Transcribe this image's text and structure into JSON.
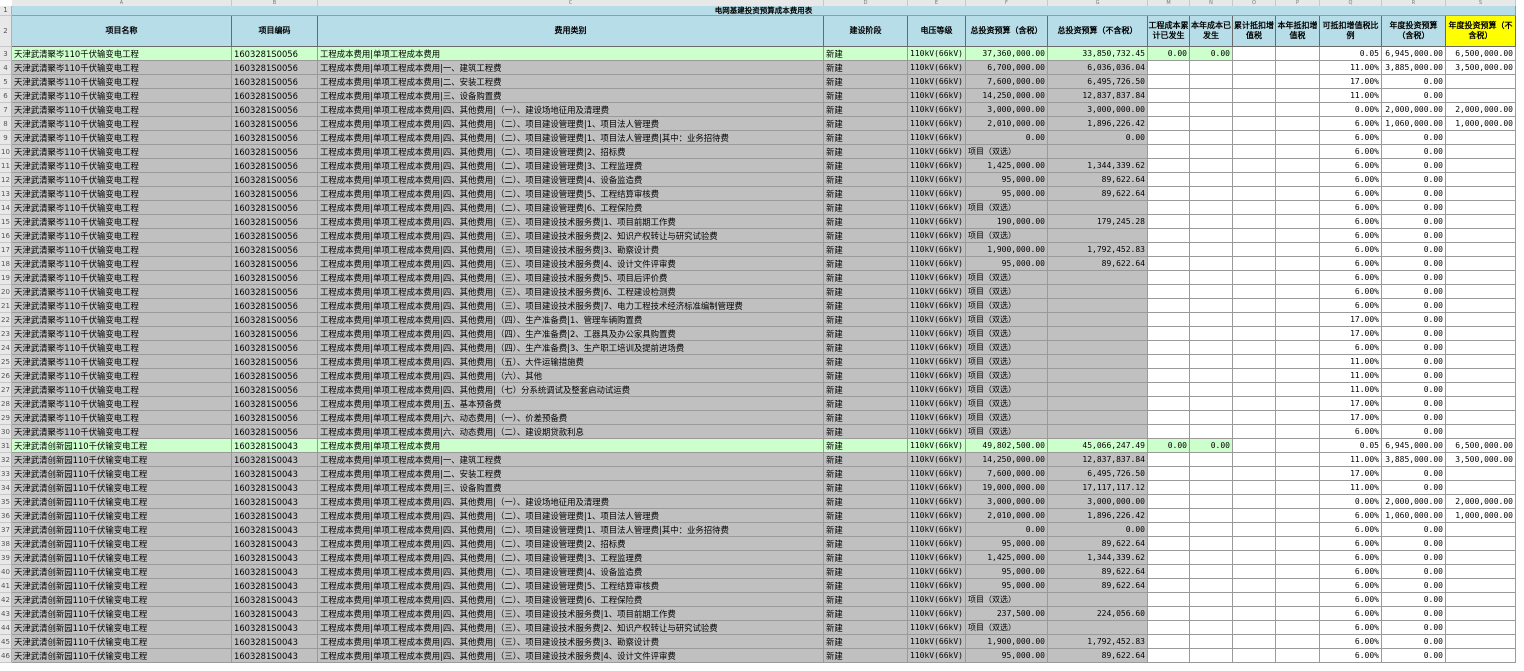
{
  "sheet": {
    "title": "电网基建投资预算成本费用表",
    "col_letters": [
      "A",
      "B",
      "C",
      "D",
      "E",
      "F",
      "G",
      "H",
      "I",
      "J",
      "K",
      "L",
      "M",
      "N",
      "O",
      "P",
      "Q",
      "R",
      "S"
    ],
    "headers": [
      "项目名称",
      "项目编码",
      "费用类别",
      "建设阶段",
      "电压等级",
      "总投资预算（含税）",
      "总投资预算（不含税）",
      "工程成本累计已发生",
      "本年成本已发生",
      "累计抵扣增值税",
      "本年抵扣增值税",
      "可抵扣增值税比例",
      "年度投资预算（含税）",
      "年度投资预算（不含税）"
    ],
    "rows": [
      {
        "n": "3",
        "name": "天津武清聚岑110千伏输变电工程",
        "code": "1603281S0056",
        "cat": "工程成本费用|单项工程成本费用",
        "stage": "新建",
        "volt": "110kV(66kV)",
        "tot": "37,360,000.00",
        "totn": "33,850,732.45",
        "m": "0.00",
        "n2": "0.00",
        "o": "",
        "p": "",
        "ratio": "0.05",
        "ann": "6,945,000.00",
        "annn": "6,500,000.00",
        "hl": true
      },
      {
        "n": "4",
        "name": "天津武清聚岑110千伏输变电工程",
        "code": "1603281S0056",
        "cat": "工程成本费用|单项工程成本费用|一、建筑工程费",
        "stage": "新建",
        "volt": "110kV(66kV)",
        "tot": "6,700,000.00",
        "totn": "6,036,036.04",
        "ratio": "11.00%",
        "ann": "3,885,000.00",
        "annn": "3,500,000.00"
      },
      {
        "n": "5",
        "name": "天津武清聚岑110千伏输变电工程",
        "code": "1603281S0056",
        "cat": "工程成本费用|单项工程成本费用|二、安装工程费",
        "stage": "新建",
        "volt": "110kV(66kV)",
        "tot": "7,600,000.00",
        "totn": "6,495,726.50",
        "ratio": "17.00%",
        "ann": "0.00",
        "annn": ""
      },
      {
        "n": "6",
        "name": "天津武清聚岑110千伏输变电工程",
        "code": "1603281S0056",
        "cat": "工程成本费用|单项工程成本费用|三、设备购置费",
        "stage": "新建",
        "volt": "110kV(66kV)",
        "tot": "14,250,000.00",
        "totn": "12,837,837.84",
        "ratio": "11.00%",
        "ann": "0.00",
        "annn": ""
      },
      {
        "n": "7",
        "name": "天津武清聚岑110千伏输变电工程",
        "code": "1603281S0056",
        "cat": "工程成本费用|单项工程成本费用|四、其他费用|（一）、建设场地征用及清理费",
        "stage": "新建",
        "volt": "110kV(66kV)",
        "tot": "3,000,000.00",
        "totn": "3,000,000.00",
        "ratio": "0.00%",
        "ann": "2,000,000.00",
        "annn": "2,000,000.00"
      },
      {
        "n": "8",
        "name": "天津武清聚岑110千伏输变电工程",
        "code": "1603281S0056",
        "cat": "工程成本费用|单项工程成本费用|四、其他费用|（二）、项目建设管理费|1、项目法人管理费",
        "stage": "新建",
        "volt": "110kV(66kV)",
        "tot": "2,010,000.00",
        "totn": "1,896,226.42",
        "ratio": "6.00%",
        "ann": "1,060,000.00",
        "annn": "1,000,000.00"
      },
      {
        "n": "9",
        "name": "天津武清聚岑110千伏输变电工程",
        "code": "1603281S0056",
        "cat": "工程成本费用|单项工程成本费用|四、其他费用|（二）、项目建设管理费|1、项目法人管理费|其中：业务招待费",
        "stage": "新建",
        "volt": "110kV(66kV)",
        "tot": "0.00",
        "totn": "0.00",
        "ratio": "6.00%",
        "ann": "0.00",
        "annn": ""
      },
      {
        "n": "10",
        "name": "天津武清聚岑110千伏输变电工程",
        "code": "1603281S0056",
        "cat": "工程成本费用|单项工程成本费用|四、其他费用|（二）、项目建设管理费|2、招标费",
        "stage": "新建",
        "volt": "110kV(66kV)",
        "tot": "项目（双选）",
        "totn": "",
        "ratio": "6.00%",
        "ann": "0.00",
        "annn": ""
      },
      {
        "n": "11",
        "name": "天津武清聚岑110千伏输变电工程",
        "code": "1603281S0056",
        "cat": "工程成本费用|单项工程成本费用|四、其他费用|（二）、项目建设管理费|3、工程监理费",
        "stage": "新建",
        "volt": "110kV(66kV)",
        "tot": "1,425,000.00",
        "totn": "1,344,339.62",
        "ratio": "6.00%",
        "ann": "0.00",
        "annn": ""
      },
      {
        "n": "12",
        "name": "天津武清聚岑110千伏输变电工程",
        "code": "1603281S0056",
        "cat": "工程成本费用|单项工程成本费用|四、其他费用|（二）、项目建设管理费|4、设备监造费",
        "stage": "新建",
        "volt": "110kV(66kV)",
        "tot": "95,000.00",
        "totn": "89,622.64",
        "ratio": "6.00%",
        "ann": "0.00",
        "annn": ""
      },
      {
        "n": "13",
        "name": "天津武清聚岑110千伏输变电工程",
        "code": "1603281S0056",
        "cat": "工程成本费用|单项工程成本费用|四、其他费用|（二）、项目建设管理费|5、工程结算审核费",
        "stage": "新建",
        "volt": "110kV(66kV)",
        "tot": "95,000.00",
        "totn": "89,622.64",
        "ratio": "6.00%",
        "ann": "0.00",
        "annn": ""
      },
      {
        "n": "14",
        "name": "天津武清聚岑110千伏输变电工程",
        "code": "1603281S0056",
        "cat": "工程成本费用|单项工程成本费用|四、其他费用|（二）、项目建设管理费|6、工程保险费",
        "stage": "新建",
        "volt": "110kV(66kV)",
        "tot": "项目（双选）",
        "totn": "",
        "ratio": "6.00%",
        "ann": "0.00",
        "annn": ""
      },
      {
        "n": "15",
        "name": "天津武清聚岑110千伏输变电工程",
        "code": "1603281S0056",
        "cat": "工程成本费用|单项工程成本费用|四、其他费用|（三）、项目建设技术服务费|1、项目前期工作费",
        "stage": "新建",
        "volt": "110kV(66kV)",
        "tot": "190,000.00",
        "totn": "179,245.28",
        "ratio": "6.00%",
        "ann": "0.00",
        "annn": ""
      },
      {
        "n": "16",
        "name": "天津武清聚岑110千伏输变电工程",
        "code": "1603281S0056",
        "cat": "工程成本费用|单项工程成本费用|四、其他费用|（三）、项目建设技术服务费|2、知识产权转让与研究试验费",
        "stage": "新建",
        "volt": "110kV(66kV)",
        "tot": "项目（双选）",
        "totn": "",
        "ratio": "6.00%",
        "ann": "0.00",
        "annn": ""
      },
      {
        "n": "17",
        "name": "天津武清聚岑110千伏输变电工程",
        "code": "1603281S0056",
        "cat": "工程成本费用|单项工程成本费用|四、其他费用|（三）、项目建设技术服务费|3、勘察设计费",
        "stage": "新建",
        "volt": "110kV(66kV)",
        "tot": "1,900,000.00",
        "totn": "1,792,452.83",
        "ratio": "6.00%",
        "ann": "0.00",
        "annn": ""
      },
      {
        "n": "18",
        "name": "天津武清聚岑110千伏输变电工程",
        "code": "1603281S0056",
        "cat": "工程成本费用|单项工程成本费用|四、其他费用|（三）、项目建设技术服务费|4、设计文件评审费",
        "stage": "新建",
        "volt": "110kV(66kV)",
        "tot": "95,000.00",
        "totn": "89,622.64",
        "ratio": "6.00%",
        "ann": "0.00",
        "annn": ""
      },
      {
        "n": "19",
        "name": "天津武清聚岑110千伏输变电工程",
        "code": "1603281S0056",
        "cat": "工程成本费用|单项工程成本费用|四、其他费用|（三）、项目建设技术服务费|5、项目后评价费",
        "stage": "新建",
        "volt": "110kV(66kV)",
        "tot": "项目（双选）",
        "totn": "",
        "ratio": "6.00%",
        "ann": "0.00",
        "annn": ""
      },
      {
        "n": "20",
        "name": "天津武清聚岑110千伏输变电工程",
        "code": "1603281S0056",
        "cat": "工程成本费用|单项工程成本费用|四、其他费用|（三）、项目建设技术服务费|6、工程建设检测费",
        "stage": "新建",
        "volt": "110kV(66kV)",
        "tot": "项目（双选）",
        "totn": "",
        "ratio": "6.00%",
        "ann": "0.00",
        "annn": ""
      },
      {
        "n": "21",
        "name": "天津武清聚岑110千伏输变电工程",
        "code": "1603281S0056",
        "cat": "工程成本费用|单项工程成本费用|四、其他费用|（三）、项目建设技术服务费|7、电力工程技术经济标准编制管理费",
        "stage": "新建",
        "volt": "110kV(66kV)",
        "tot": "项目（双选）",
        "totn": "",
        "ratio": "6.00%",
        "ann": "0.00",
        "annn": ""
      },
      {
        "n": "22",
        "name": "天津武清聚岑110千伏输变电工程",
        "code": "1603281S0056",
        "cat": "工程成本费用|单项工程成本费用|四、其他费用|（四）、生产准备费|1、管理车辆购置费",
        "stage": "新建",
        "volt": "110kV(66kV)",
        "tot": "项目（双选）",
        "totn": "",
        "ratio": "17.00%",
        "ann": "0.00",
        "annn": ""
      },
      {
        "n": "23",
        "name": "天津武清聚岑110千伏输变电工程",
        "code": "1603281S0056",
        "cat": "工程成本费用|单项工程成本费用|四、其他费用|（四）、生产准备费|2、工器具及办公家具购置费",
        "stage": "新建",
        "volt": "110kV(66kV)",
        "tot": "项目（双选）",
        "totn": "",
        "ratio": "17.00%",
        "ann": "0.00",
        "annn": ""
      },
      {
        "n": "24",
        "name": "天津武清聚岑110千伏输变电工程",
        "code": "1603281S0056",
        "cat": "工程成本费用|单项工程成本费用|四、其他费用|（四）、生产准备费|3、生产职工培训及提前进场费",
        "stage": "新建",
        "volt": "110kV(66kV)",
        "tot": "项目（双选）",
        "totn": "",
        "ratio": "6.00%",
        "ann": "0.00",
        "annn": ""
      },
      {
        "n": "25",
        "name": "天津武清聚岑110千伏输变电工程",
        "code": "1603281S0056",
        "cat": "工程成本费用|单项工程成本费用|四、其他费用|（五）、大件运输措施费",
        "stage": "新建",
        "volt": "110kV(66kV)",
        "tot": "项目（双选）",
        "totn": "",
        "ratio": "11.00%",
        "ann": "0.00",
        "annn": ""
      },
      {
        "n": "26",
        "name": "天津武清聚岑110千伏输变电工程",
        "code": "1603281S0056",
        "cat": "工程成本费用|单项工程成本费用|四、其他费用|（六）、其他",
        "stage": "新建",
        "volt": "110kV(66kV)",
        "tot": "项目（双选）",
        "totn": "",
        "ratio": "11.00%",
        "ann": "0.00",
        "annn": ""
      },
      {
        "n": "27",
        "name": "天津武清聚岑110千伏输变电工程",
        "code": "1603281S0056",
        "cat": "工程成本费用|单项工程成本费用|四、其他费用|（七）分系统调试及整套启动试运费",
        "stage": "新建",
        "volt": "110kV(66kV)",
        "tot": "项目（双选）",
        "totn": "",
        "ratio": "11.00%",
        "ann": "0.00",
        "annn": ""
      },
      {
        "n": "28",
        "name": "天津武清聚岑110千伏输变电工程",
        "code": "1603281S0056",
        "cat": "工程成本费用|单项工程成本费用|五、基本预备费",
        "stage": "新建",
        "volt": "110kV(66kV)",
        "tot": "项目（双选）",
        "totn": "",
        "ratio": "17.00%",
        "ann": "0.00",
        "annn": ""
      },
      {
        "n": "29",
        "name": "天津武清聚岑110千伏输变电工程",
        "code": "1603281S0056",
        "cat": "工程成本费用|单项工程成本费用|六、动态费用|（一）、价差预备费",
        "stage": "新建",
        "volt": "110kV(66kV)",
        "tot": "项目（双选）",
        "totn": "",
        "ratio": "17.00%",
        "ann": "0.00",
        "annn": ""
      },
      {
        "n": "30",
        "name": "天津武清聚岑110千伏输变电工程",
        "code": "1603281S0056",
        "cat": "工程成本费用|单项工程成本费用|六、动态费用|（二）、建设期贷款利息",
        "stage": "新建",
        "volt": "110kV(66kV)",
        "tot": "项目（双选）",
        "totn": "",
        "ratio": "6.00%",
        "ann": "0.00",
        "annn": ""
      },
      {
        "n": "31",
        "name": "天津武清创新园110千伏输变电工程",
        "code": "1603281S0043",
        "cat": "工程成本费用|单项工程成本费用",
        "stage": "新建",
        "volt": "110kV(66kV)",
        "tot": "49,802,500.00",
        "totn": "45,066,247.49",
        "m": "0.00",
        "n2": "0.00",
        "ratio": "0.05",
        "ann": "6,945,000.00",
        "annn": "6,500,000.00",
        "hl": true
      },
      {
        "n": "32",
        "name": "天津武清创新园110千伏输变电工程",
        "code": "1603281S0043",
        "cat": "工程成本费用|单项工程成本费用|一、建筑工程费",
        "stage": "新建",
        "volt": "110kV(66kV)",
        "tot": "14,250,000.00",
        "totn": "12,837,837.84",
        "ratio": "11.00%",
        "ann": "3,885,000.00",
        "annn": "3,500,000.00"
      },
      {
        "n": "33",
        "name": "天津武清创新园110千伏输变电工程",
        "code": "1603281S0043",
        "cat": "工程成本费用|单项工程成本费用|二、安装工程费",
        "stage": "新建",
        "volt": "110kV(66kV)",
        "tot": "7,600,000.00",
        "totn": "6,495,726.50",
        "ratio": "17.00%",
        "ann": "0.00",
        "annn": ""
      },
      {
        "n": "34",
        "name": "天津武清创新园110千伏输变电工程",
        "code": "1603281S0043",
        "cat": "工程成本费用|单项工程成本费用|三、设备购置费",
        "stage": "新建",
        "volt": "110kV(66kV)",
        "tot": "19,000,000.00",
        "totn": "17,117,117.12",
        "ratio": "11.00%",
        "ann": "0.00",
        "annn": ""
      },
      {
        "n": "35",
        "name": "天津武清创新园110千伏输变电工程",
        "code": "1603281S0043",
        "cat": "工程成本费用|单项工程成本费用|四、其他费用|（一）、建设场地征用及清理费",
        "stage": "新建",
        "volt": "110kV(66kV)",
        "tot": "3,000,000.00",
        "totn": "3,000,000.00",
        "ratio": "0.00%",
        "ann": "2,000,000.00",
        "annn": "2,000,000.00"
      },
      {
        "n": "36",
        "name": "天津武清创新园110千伏输变电工程",
        "code": "1603281S0043",
        "cat": "工程成本费用|单项工程成本费用|四、其他费用|（二）、项目建设管理费|1、项目法人管理费",
        "stage": "新建",
        "volt": "110kV(66kV)",
        "tot": "2,010,000.00",
        "totn": "1,896,226.42",
        "ratio": "6.00%",
        "ann": "1,060,000.00",
        "annn": "1,000,000.00"
      },
      {
        "n": "37",
        "name": "天津武清创新园110千伏输变电工程",
        "code": "1603281S0043",
        "cat": "工程成本费用|单项工程成本费用|四、其他费用|（二）、项目建设管理费|1、项目法人管理费|其中：业务招待费",
        "stage": "新建",
        "volt": "110kV(66kV)",
        "tot": "0.00",
        "totn": "0.00",
        "ratio": "6.00%",
        "ann": "0.00",
        "annn": ""
      },
      {
        "n": "38",
        "name": "天津武清创新园110千伏输变电工程",
        "code": "1603281S0043",
        "cat": "工程成本费用|单项工程成本费用|四、其他费用|（二）、项目建设管理费|2、招标费",
        "stage": "新建",
        "volt": "110kV(66kV)",
        "tot": "95,000.00",
        "totn": "89,622.64",
        "ratio": "6.00%",
        "ann": "0.00",
        "annn": ""
      },
      {
        "n": "39",
        "name": "天津武清创新园110千伏输变电工程",
        "code": "1603281S0043",
        "cat": "工程成本费用|单项工程成本费用|四、其他费用|（二）、项目建设管理费|3、工程监理费",
        "stage": "新建",
        "volt": "110kV(66kV)",
        "tot": "1,425,000.00",
        "totn": "1,344,339.62",
        "ratio": "6.00%",
        "ann": "0.00",
        "annn": ""
      },
      {
        "n": "40",
        "name": "天津武清创新园110千伏输变电工程",
        "code": "1603281S0043",
        "cat": "工程成本费用|单项工程成本费用|四、其他费用|（二）、项目建设管理费|4、设备监造费",
        "stage": "新建",
        "volt": "110kV(66kV)",
        "tot": "95,000.00",
        "totn": "89,622.64",
        "ratio": "6.00%",
        "ann": "0.00",
        "annn": ""
      },
      {
        "n": "41",
        "name": "天津武清创新园110千伏输变电工程",
        "code": "1603281S0043",
        "cat": "工程成本费用|单项工程成本费用|四、其他费用|（二）、项目建设管理费|5、工程结算审核费",
        "stage": "新建",
        "volt": "110kV(66kV)",
        "tot": "95,000.00",
        "totn": "89,622.64",
        "ratio": "6.00%",
        "ann": "0.00",
        "annn": ""
      },
      {
        "n": "42",
        "name": "天津武清创新园110千伏输变电工程",
        "code": "1603281S0043",
        "cat": "工程成本费用|单项工程成本费用|四、其他费用|（二）、项目建设管理费|6、工程保险费",
        "stage": "新建",
        "volt": "110kV(66kV)",
        "tot": "项目（双选）",
        "totn": "",
        "ratio": "6.00%",
        "ann": "0.00",
        "annn": ""
      },
      {
        "n": "43",
        "name": "天津武清创新园110千伏输变电工程",
        "code": "1603281S0043",
        "cat": "工程成本费用|单项工程成本费用|四、其他费用|（三）、项目建设技术服务费|1、项目前期工作费",
        "stage": "新建",
        "volt": "110kV(66kV)",
        "tot": "237,500.00",
        "totn": "224,056.60",
        "ratio": "6.00%",
        "ann": "0.00",
        "annn": ""
      },
      {
        "n": "44",
        "name": "天津武清创新园110千伏输变电工程",
        "code": "1603281S0043",
        "cat": "工程成本费用|单项工程成本费用|四、其他费用|（三）、项目建设技术服务费|2、知识产权转让与研究试验费",
        "stage": "新建",
        "volt": "110kV(66kV)",
        "tot": "项目（双选）",
        "totn": "",
        "ratio": "6.00%",
        "ann": "0.00",
        "annn": ""
      },
      {
        "n": "45",
        "name": "天津武清创新园110千伏输变电工程",
        "code": "1603281S0043",
        "cat": "工程成本费用|单项工程成本费用|四、其他费用|（三）、项目建设技术服务费|3、勘察设计费",
        "stage": "新建",
        "volt": "110kV(66kV)",
        "tot": "1,900,000.00",
        "totn": "1,792,452.83",
        "ratio": "6.00%",
        "ann": "0.00",
        "annn": ""
      },
      {
        "n": "46",
        "name": "天津武清创新园110千伏输变电工程",
        "code": "1603281S0043",
        "cat": "工程成本费用|单项工程成本费用|四、其他费用|（三）、项目建设技术服务费|4、设计文件评审费",
        "stage": "新建",
        "volt": "110kV(66kV)",
        "tot": "95,000.00",
        "totn": "89,622.64",
        "ratio": "6.00%",
        "ann": "0.00",
        "annn": ""
      }
    ]
  },
  "colors": {
    "header_bg": "#b7dee8",
    "highlight_row": "#ccffcc",
    "gray_cell": "#c0c0c0",
    "yellow_header": "#ffff00",
    "title_bg": "#b7dee8"
  }
}
